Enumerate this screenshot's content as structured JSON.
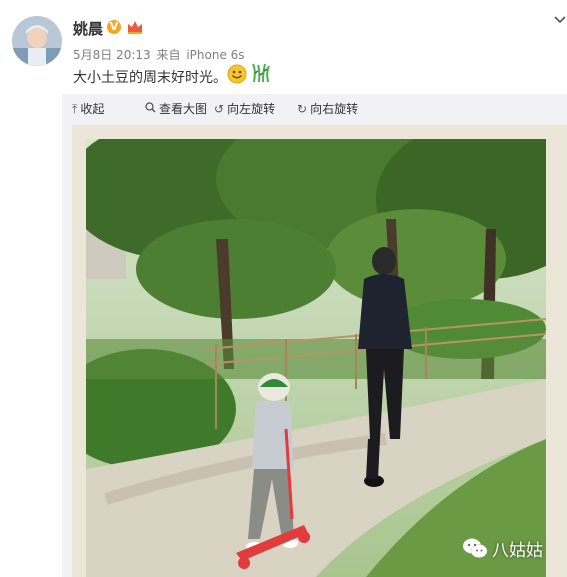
{
  "post": {
    "username": "姚晨",
    "verified_badge": "V",
    "date": "5月8日 20:13",
    "source_prefix": "来自",
    "source": "iPhone 6s",
    "text": "大小土豆的周末好时光。"
  },
  "toolbar": {
    "collapse_label": "收起",
    "view_large_label": "查看大图",
    "rotate_left_label": "向左旋转",
    "rotate_right_label": "向右旋转"
  },
  "watermark": {
    "text": "八姑姑"
  },
  "icons": [
    "avatar",
    "verified-badge-icon",
    "crown-icon",
    "smile-emoji-icon",
    "grass-emoji-icon",
    "chevron-down-icon",
    "collapse-up-icon",
    "zoom-icon",
    "rotate-left-icon",
    "rotate-right-icon",
    "wechat-icon"
  ],
  "colors": {
    "username": "#333333",
    "meta": "#808080",
    "toolbar_bg": "#f2f2f5",
    "badge": "#f5a623"
  }
}
